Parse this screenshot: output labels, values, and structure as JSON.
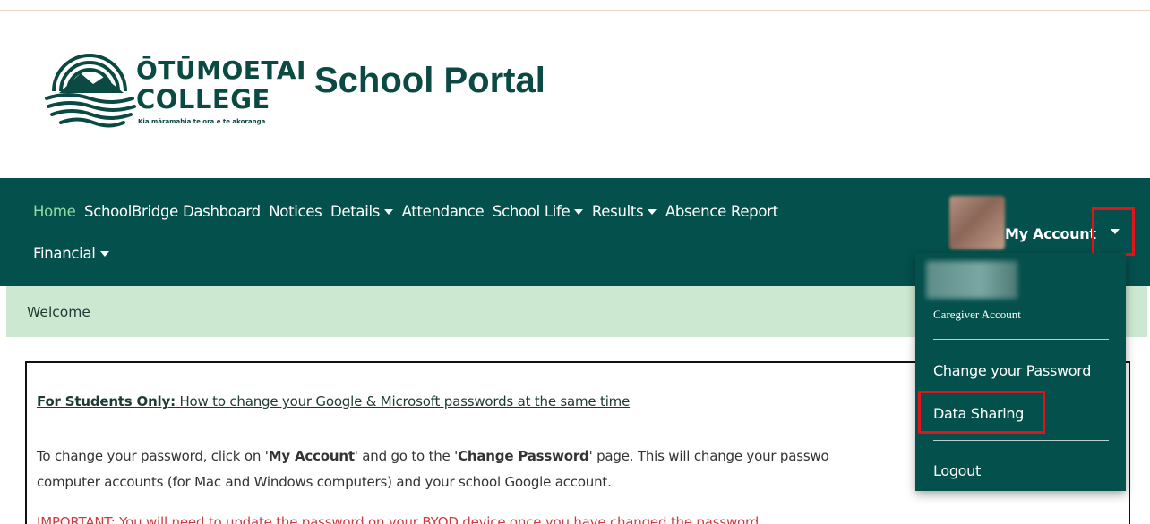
{
  "header": {
    "logo_line1": "ŌTŪMOETAI",
    "logo_line2": "COLLEGE",
    "logo_tagline": "Kia māramahia te ora e te akoranga",
    "portal_title": "School Portal"
  },
  "nav": {
    "items": [
      {
        "label": "Home",
        "active": true,
        "has_caret": false
      },
      {
        "label": "SchoolBridge Dashboard",
        "has_caret": false
      },
      {
        "label": "Notices",
        "has_caret": false
      },
      {
        "label": "Details",
        "has_caret": true
      },
      {
        "label": "Attendance",
        "has_caret": false
      },
      {
        "label": "School Life",
        "has_caret": true
      },
      {
        "label": "Results",
        "has_caret": true
      },
      {
        "label": "Absence Report",
        "has_caret": false
      },
      {
        "label": "Financial",
        "has_caret": true
      }
    ],
    "account_label": "My Account"
  },
  "breadcrumb": {
    "label": "Welcome"
  },
  "notice": {
    "students_only": "For Students Only:",
    "link_text": " How to change your Google & Microsoft passwords at the same time",
    "para_intro": "To change your password, click on '",
    "para_my_account": "My Account",
    "para_middle": "' and go to the '",
    "para_change_password": "Change Password",
    "para_rest": "' page. This will change your passwo",
    "para_line2": "computer accounts (for Mac and Windows computers) and your school Google account.",
    "warning": "IMPORTANT: You will need to update the password on your BYOD device once you have changed the password."
  },
  "account_menu": {
    "role": "Caregiver Account",
    "change_password": "Change your Password",
    "data_sharing": "Data Sharing",
    "logout": "Logout"
  },
  "colors": {
    "nav_bg": "#04504c",
    "active_link": "#8fdca7",
    "breadcrumb_bg": "#cde8d1",
    "highlight": "#e0141b",
    "brand": "#0b4a43"
  }
}
